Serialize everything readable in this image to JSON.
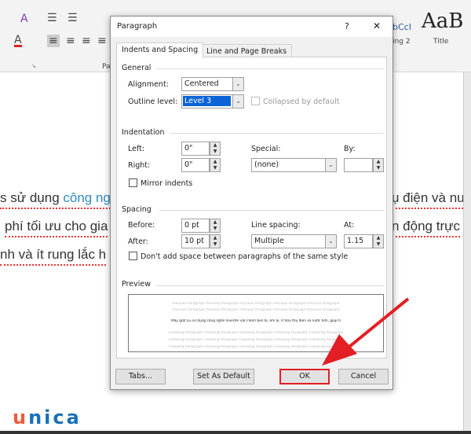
{
  "ribbon": {
    "group_label_partial": "Pa",
    "styles": [
      {
        "preview": "bCcI",
        "label": "ing 2"
      },
      {
        "preview": "AaB",
        "label": "Title"
      }
    ]
  },
  "document": {
    "lines_left": [
      "s sử dụng ",
      "công ng",
      " phí tối ưu cho gia",
      "nh và ít rung lắc h"
    ],
    "lines_right": [
      "ụ điện và nư",
      "n động trực"
    ]
  },
  "dialog": {
    "title": "Paragraph",
    "help": "?",
    "close": "✕",
    "tabs": [
      {
        "label": "Indents and Spacing",
        "active": true
      },
      {
        "label": "Line and Page Breaks",
        "active": false
      }
    ],
    "general": {
      "heading": "General",
      "alignment_label": "Alignment:",
      "alignment_value": "Centered",
      "outline_label": "Outline level:",
      "outline_value": "Level 3",
      "collapsed_label": "Collapsed by default",
      "collapsed_checked": false
    },
    "indentation": {
      "heading": "Indentation",
      "left_label": "Left:",
      "left_value": "0\"",
      "right_label": "Right:",
      "right_value": "0\"",
      "special_label": "Special:",
      "special_value": "(none)",
      "by_label": "By:",
      "by_value": "",
      "mirror_label": "Mirror indents",
      "mirror_checked": false
    },
    "spacing": {
      "heading": "Spacing",
      "before_label": "Before:",
      "before_value": "0 pt",
      "after_label": "After:",
      "after_value": "10 pt",
      "line_label": "Line spacing:",
      "line_value": "Multiple",
      "at_label": "At:",
      "at_value": "1.15",
      "dont_add_label": "Don't add space between paragraphs of the same style",
      "dont_add_checked": false
    },
    "preview": {
      "heading": "Preview",
      "previous": "Previous Paragraph Previous Paragraph Previous Paragraph Previous Paragraph Previous Paragraph",
      "sample": "Máy giặt LG sử dụng công nghệ Inverter vận hành bền bỉ, êm ái, ít tiêu thụ điện và nước hơn, giúp ti",
      "following": "Following Paragraph Following Paragraph Following Paragraph Following Paragraph Following Paragraph"
    },
    "buttons": {
      "tabs": "Tabs...",
      "set_default": "Set As Default",
      "ok": "OK",
      "cancel": "Cancel"
    }
  },
  "annotation": {
    "arrow_color": "#e31e24"
  },
  "logo": {
    "text": "unica",
    "first": "u",
    "rest": "nica",
    "colors": [
      "#f15a3a",
      "#1a6fb5"
    ]
  }
}
